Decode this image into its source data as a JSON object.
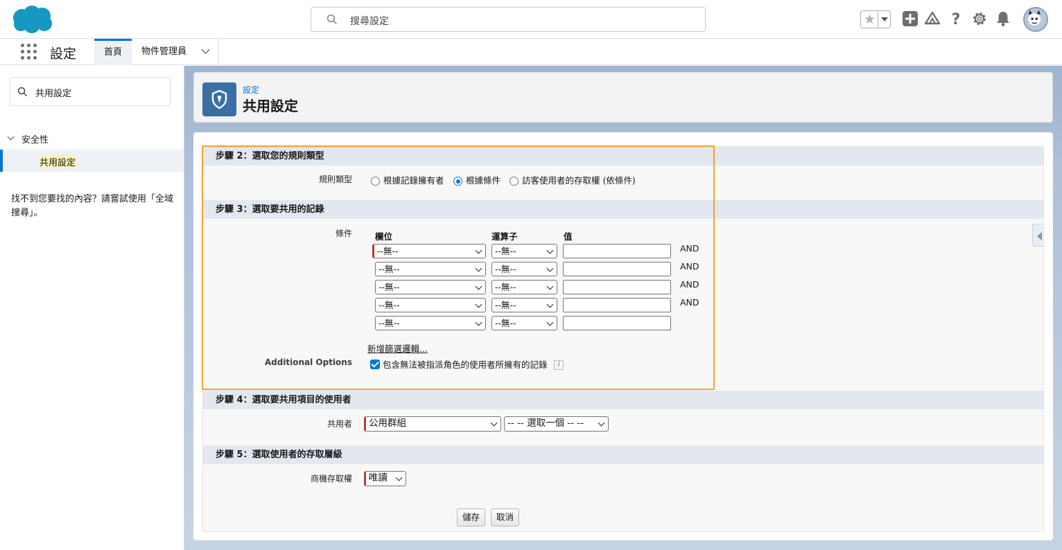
{
  "header": {
    "search_placeholder": "搜尋設定"
  },
  "nav": {
    "app_name": "設定",
    "tab_home": "首頁",
    "tab_object_manager": "物件管理員"
  },
  "sidebar": {
    "quick_find_value": "共用設定",
    "section": "安全性",
    "item": "共用設定",
    "not_found": "找不到您要找的內容？請嘗試使用「全域搜尋」。"
  },
  "page": {
    "breadcrumb": "設定",
    "title": "共用設定"
  },
  "step2": {
    "title": "步驟 2：選取您的規則類型",
    "rule_type_label": "規則類型",
    "options": [
      "根據記錄擁有者",
      "根據條件",
      "訪客使用者的存取權 (依條件)"
    ],
    "selected_index": 1
  },
  "step3": {
    "title": "步驟 3：選取要共用的記錄",
    "criteria_label": "條件",
    "col_field": "欄位",
    "col_operator": "運算子",
    "col_value": "值",
    "rows": [
      {
        "field": "--無--",
        "operator": "--無--",
        "value": "",
        "conj": "AND"
      },
      {
        "field": "--無--",
        "operator": "--無--",
        "value": "",
        "conj": "AND"
      },
      {
        "field": "--無--",
        "operator": "--無--",
        "value": "",
        "conj": "AND"
      },
      {
        "field": "--無--",
        "operator": "--無--",
        "value": "",
        "conj": "AND"
      },
      {
        "field": "--無--",
        "operator": "--無--",
        "value": "",
        "conj": ""
      }
    ],
    "add_filter_logic": "新增篩選邏輯...",
    "additional_options_label": "Additional Options",
    "include_option": "包含無法被指派角色的使用者所擁有的記錄",
    "include_checked": true
  },
  "step4": {
    "title": "步驟 4：選取要共用項目的使用者",
    "share_with_label": "共用者",
    "share_type": "公用群組",
    "share_target": "-- -- 選取一個 -- --"
  },
  "step5": {
    "title": "步驟 5：選取使用者的存取層級",
    "access_label": "商機存取權",
    "access_value": "唯讀"
  },
  "buttons": {
    "save": "儲存",
    "cancel": "取消"
  },
  "colors": {
    "accent": "#0176d3",
    "highlight_border": "#f0a12b",
    "required_bar": "#c23934"
  }
}
